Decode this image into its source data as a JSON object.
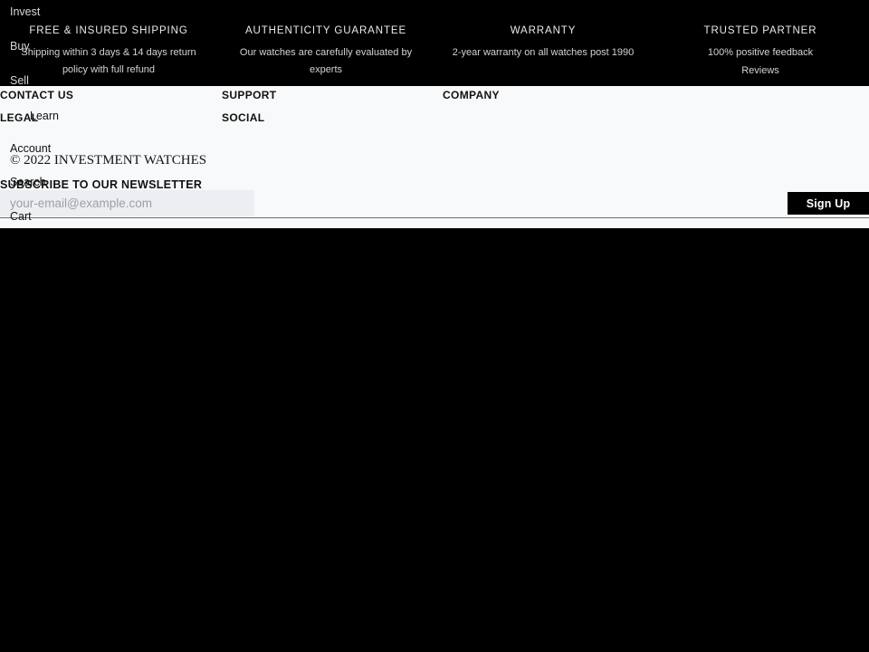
{
  "page": {
    "background": "#000000",
    "footer_background": "#f8f9fb",
    "accent": "#000000"
  },
  "trust_banner": {
    "columns": [
      {
        "title": "FREE & INSURED SHIPPING",
        "description": "Shipping within 3 days & 14 days return policy with full refund",
        "link": ""
      },
      {
        "title": "AUTHENTICITY GUARANTEE",
        "description": "Our watches are carefully evaluated by experts",
        "link": ""
      },
      {
        "title": "WARRANTY",
        "description": "2-year warranty on all watches post 1990",
        "link": ""
      },
      {
        "title": "TRUSTED PARTNER",
        "description": "100% positive feedback",
        "link": "Reviews"
      }
    ]
  },
  "nav": {
    "items": [
      {
        "label": "Invest"
      },
      {
        "label": "Buy"
      },
      {
        "label": "Sell"
      },
      {
        "label": "Learn"
      },
      {
        "label": "Account"
      },
      {
        "label": "Search"
      },
      {
        "label": "Cart"
      }
    ]
  },
  "footer": {
    "headings": {
      "contact": "CONTACT US",
      "support": "SUPPORT",
      "company": "COMPANY",
      "legal": "LEGAL",
      "social": "SOCIAL"
    },
    "copyright": "© 2022 INVESTMENT WATCHES"
  },
  "newsletter": {
    "title": "SUBSCRIBE TO OUR NEWSLETTER",
    "placeholder": "your-email@example.com",
    "value": "",
    "submit_label": "Sign Up"
  }
}
